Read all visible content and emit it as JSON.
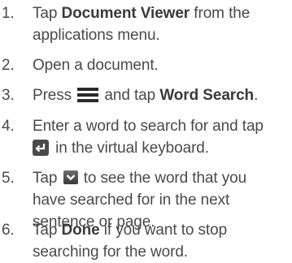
{
  "steps": [
    {
      "number": "1.",
      "pre": "Tap ",
      "bold": "Document Viewer",
      "post": " from the",
      "line2": "applications menu."
    },
    {
      "number": "2.",
      "text": "Open a document."
    },
    {
      "number": "3.",
      "pre": "Press ",
      "icon": "menu-icon",
      "mid": " and tap ",
      "bold": "Word Search",
      "post": "."
    },
    {
      "number": "4.",
      "line1": "Enter a word to search for and tap",
      "icon": "enter-key-icon",
      "line2": " in the virtual keyboard."
    },
    {
      "number": "5.",
      "pre": "Tap ",
      "icon": "down-arrow-icon",
      "post": " to see the word that you",
      "line2": "have searched for in the next",
      "line3": "sentence or page."
    },
    {
      "number": "6.",
      "pre": "Tap ",
      "bold": "Done",
      "post": " if you want to stop",
      "line2": "searching for the word."
    }
  ]
}
